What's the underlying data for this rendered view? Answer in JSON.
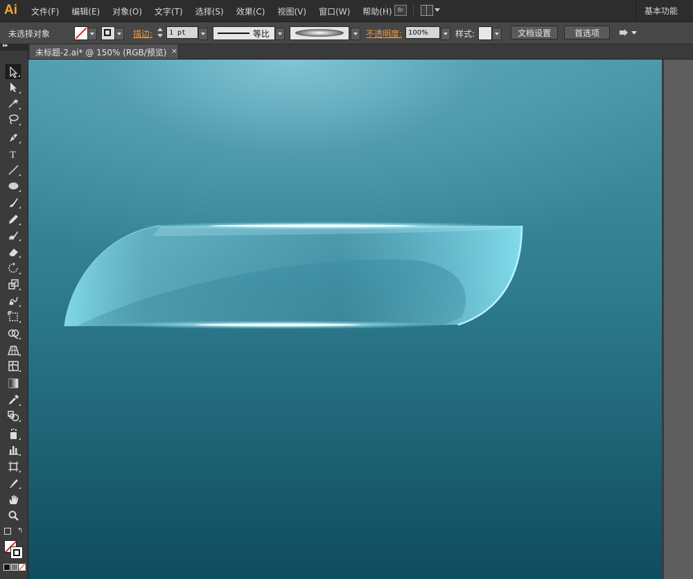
{
  "app": {
    "logo": "Ai",
    "workspace": "基本功能"
  },
  "menu": [
    "文件(F)",
    "编辑(E)",
    "对象(O)",
    "文字(T)",
    "选择(S)",
    "效果(C)",
    "视图(V)",
    "窗口(W)",
    "帮助(H)"
  ],
  "bridge_label": "Br",
  "control": {
    "selection": "未选择对象",
    "stroke_label": "描边:",
    "stroke_weight": "1 pt",
    "stroke_profile": "等比",
    "opacity_label": "不透明度:",
    "opacity_value": "100%",
    "style_label": "样式:",
    "doc_setup": "文档设置",
    "preferences": "首选项"
  },
  "tab": {
    "title": "未标题-2.ai* @ 150% (RGB/预览)",
    "close": "×"
  },
  "tools": [
    {
      "name": "selection-tool-icon",
      "icon": "arrow"
    },
    {
      "name": "direct-selection-tool-icon",
      "icon": "arrow-white"
    },
    {
      "name": "magic-wand-tool-icon",
      "icon": "wand"
    },
    {
      "name": "lasso-tool-icon",
      "icon": "lasso"
    },
    {
      "name": "pen-tool-icon",
      "icon": "pen"
    },
    {
      "name": "type-tool-icon",
      "icon": "type"
    },
    {
      "name": "line-tool-icon",
      "icon": "line"
    },
    {
      "name": "ellipse-tool-icon",
      "icon": "ellipse"
    },
    {
      "name": "paintbrush-tool-icon",
      "icon": "brush"
    },
    {
      "name": "pencil-tool-icon",
      "icon": "pencil"
    },
    {
      "name": "blob-brush-tool-icon",
      "icon": "blob"
    },
    {
      "name": "eraser-tool-icon",
      "icon": "eraser"
    },
    {
      "name": "rotate-tool-icon",
      "icon": "rotate"
    },
    {
      "name": "scale-tool-icon",
      "icon": "scale"
    },
    {
      "name": "warp-tool-icon",
      "icon": "warp"
    },
    {
      "name": "free-transform-tool-icon",
      "icon": "transform"
    },
    {
      "name": "shape-builder-tool-icon",
      "icon": "shape"
    },
    {
      "name": "perspective-grid-tool-icon",
      "icon": "perspective"
    },
    {
      "name": "mesh-tool-icon",
      "icon": "mesh"
    },
    {
      "name": "gradient-tool-icon",
      "icon": "gradient"
    },
    {
      "name": "eyedropper-tool-icon",
      "icon": "eyedropper"
    },
    {
      "name": "blend-tool-icon",
      "icon": "blend"
    },
    {
      "name": "symbol-sprayer-tool-icon",
      "icon": "symbol"
    },
    {
      "name": "column-graph-tool-icon",
      "icon": "graph"
    },
    {
      "name": "artboard-tool-icon",
      "icon": "artboard"
    },
    {
      "name": "slice-tool-icon",
      "icon": "slice"
    },
    {
      "name": "hand-tool-icon",
      "icon": "hand"
    },
    {
      "name": "zoom-tool-icon",
      "icon": "zoom"
    }
  ],
  "colors": {
    "accent_orange": "#f29a35",
    "canvas_top": "#6fb9cd",
    "canvas_bottom": "#0f4c5e",
    "shape_light": "#8ae6f5"
  }
}
